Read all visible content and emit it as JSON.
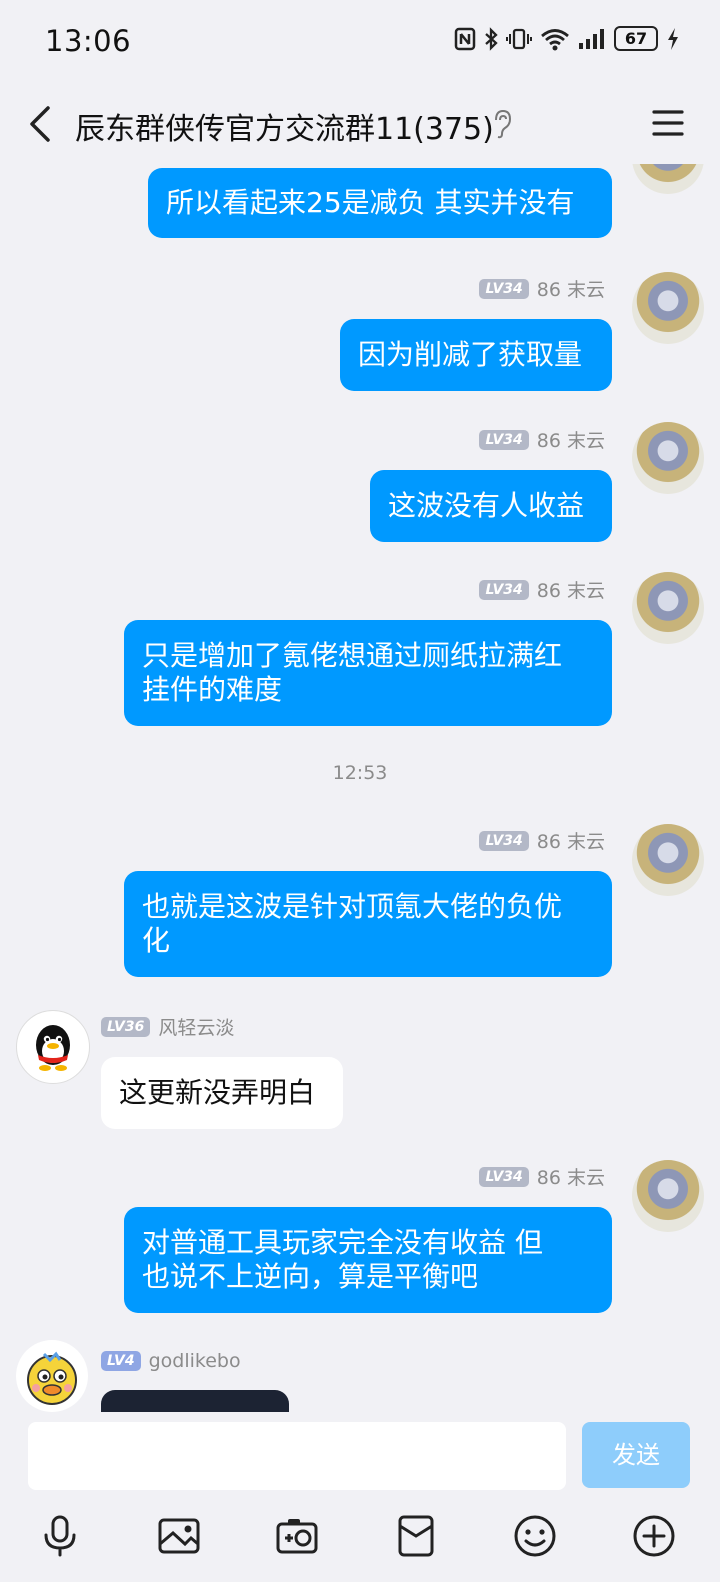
{
  "status_bar": {
    "time": "13:06",
    "battery": "67",
    "icons": [
      "nfc-icon",
      "bluetooth-icon",
      "vibrate-icon",
      "wifi-icon",
      "signal-icon",
      "battery-icon",
      "charging-icon"
    ]
  },
  "header": {
    "title": "辰东群侠传官方交流群11(375)",
    "icons": [
      "back-icon",
      "ear-icon",
      "menu-icon"
    ]
  },
  "messages": [
    {
      "side": "out",
      "sender": "86 末云",
      "level": "LV34",
      "text": "所以看起来25是减负 其实并没有"
    },
    {
      "side": "out",
      "sender": "86 末云",
      "level": "LV34",
      "text": "因为削减了获取量"
    },
    {
      "side": "out",
      "sender": "86 末云",
      "level": "LV34",
      "text": "这波没有人收益"
    },
    {
      "side": "out",
      "sender": "86 末云",
      "level": "LV34",
      "text_lines": [
        "只是增加了氪佬想通过厕纸拉满红",
        "挂件的难度"
      ]
    },
    {
      "timestamp": "12:53"
    },
    {
      "side": "out",
      "sender": "86 末云",
      "level": "LV34",
      "text_lines": [
        "也就是这波是针对顶氪大佬的负优",
        "化"
      ]
    },
    {
      "side": "in",
      "sender": "风轻云淡",
      "level": "LV36",
      "text": "这更新没弄明白"
    },
    {
      "side": "out",
      "sender": "86 末云",
      "level": "LV34",
      "text_lines": [
        "对普通工具玩家完全没有收益 但",
        "也说不上逆向，算是平衡吧"
      ]
    },
    {
      "side": "in",
      "sender": "godlikebo",
      "level": "LV4",
      "text": ""
    }
  ],
  "input": {
    "placeholder": "",
    "send_label": "发送"
  },
  "toolbar": [
    "mic-icon",
    "image-icon",
    "camera-icon",
    "red-packet-icon",
    "emoji-icon",
    "plus-icon"
  ],
  "colors": {
    "outgoing_bubble": "#0099ff",
    "incoming_bubble": "#ffffff",
    "background": "#f1f1f5",
    "send_button": "#8ecdfb"
  }
}
